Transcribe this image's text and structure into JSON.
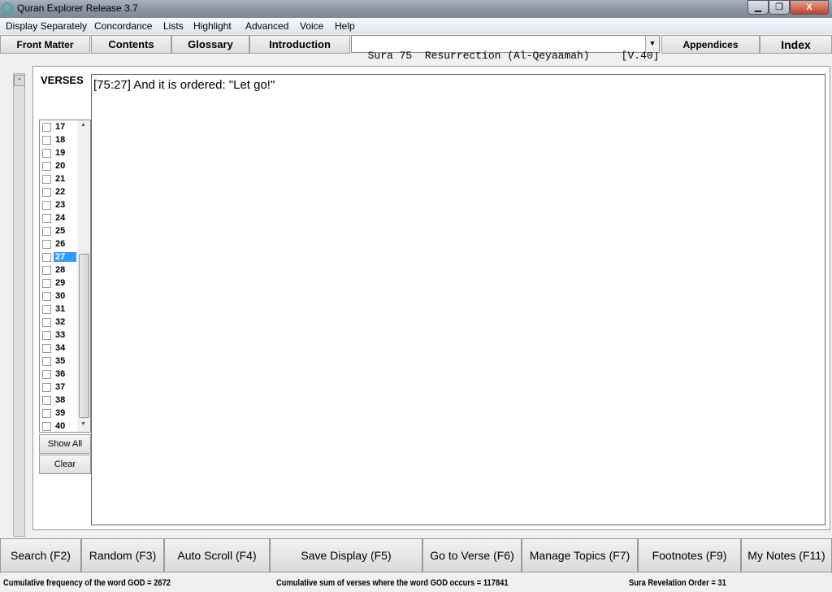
{
  "window": {
    "title": "Quran Explorer Release 3.7",
    "controls": {
      "minimize": "▁",
      "restore": "❐",
      "close": "X"
    }
  },
  "menu": [
    "Display Separately",
    "Concordance",
    "Lists",
    "Highlight",
    "Advanced",
    "Voice",
    "Help"
  ],
  "toolbar": {
    "front_matter": "Front Matter",
    "contents": "Contents",
    "glossary": "Glossary",
    "introduction": "Introduction",
    "sura_select": "Sura 75  Resurrection (Al-Qeyaamah)     [V.40]",
    "appendices": "Appendices",
    "index": "Index"
  },
  "panel": {
    "collapse": "-",
    "verses_label": "VERSES",
    "verse_text": "[75:27] And it is ordered: \"Let go!\"",
    "verses": [
      "17",
      "18",
      "19",
      "20",
      "21",
      "22",
      "23",
      "24",
      "25",
      "26",
      "27",
      "28",
      "29",
      "30",
      "31",
      "32",
      "33",
      "34",
      "35",
      "36",
      "37",
      "38",
      "39",
      "40"
    ],
    "selected_verse": "27",
    "show_all": "Show All",
    "clear": "Clear"
  },
  "bottom": [
    "Search (F2)",
    "Random (F3)",
    "Auto Scroll (F4)",
    "Save Display (F5)",
    "Go to Verse (F6)",
    "Manage Topics (F7)",
    "Footnotes (F9)",
    "My Notes (F11)"
  ],
  "status": {
    "god_frequency": "Cumulative frequency of the word GOD = 2672",
    "god_verse_sum": "Cumulative sum of verses where the word GOD occurs = 117841",
    "revelation_order": "Sura Revelation Order = 31"
  },
  "colors": {
    "selection": "#3399ff"
  }
}
